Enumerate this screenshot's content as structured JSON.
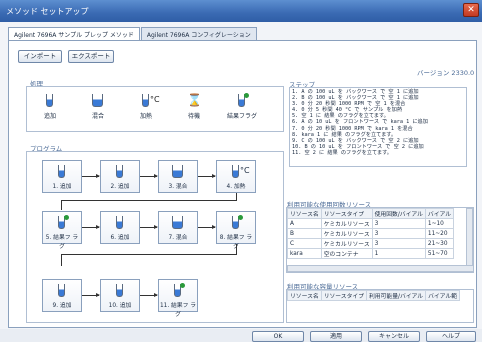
{
  "window": {
    "title": "メソッド セットアップ"
  },
  "tabs": [
    "Agilent 7696A サンプル プレップ メソッド",
    "Agilent 7696A コンフィグレーション"
  ],
  "toolbar": {
    "import_label": "インポート",
    "export_label": "エクスポート"
  },
  "version": "バージョン 2330.0",
  "process": {
    "label": "処理",
    "items": [
      {
        "label": "追加",
        "icon": "add-tube-icon"
      },
      {
        "label": "混合",
        "icon": "mix-tube-icon"
      },
      {
        "label": "加熱",
        "icon": "heat-tube-icon",
        "unit": "°C"
      },
      {
        "label": "待機",
        "icon": "hourglass-icon"
      },
      {
        "label": "結果フラグ",
        "icon": "result-flag-icon"
      }
    ]
  },
  "steps": {
    "label": "ステップ",
    "lines": [
      "1. A の 100 uL を バックワース で 空 1 に追加",
      "2. B の 100 uL を バックワース で 空 1 に追加",
      "3. 0 分 20 秒間 1000 RPM で 空 1 を混合",
      "4. 0 分 5 秒間 40 °C で サンプル を加熱",
      "5. 空 1 に 結果 のフラグを立てます。",
      "6. A の 10 uL を フロントワース で kara 1 に追加",
      "7. 0 分 20 秒間 1000 RPM で kara 1 を混合",
      "8. kara 1 に 結果 のフラグを立てます。",
      "9. C の 100 uL を バックワース で 空 2 に追加",
      "10. B の 10 uL を フロントワース で 空 2 に追加",
      "11. 空 2 に 結果 のフラグを立てます。"
    ]
  },
  "program": {
    "label": "プログラム",
    "cards": [
      {
        "label": "1. 追加",
        "icon": "add-tube-icon"
      },
      {
        "label": "2. 追加",
        "icon": "add-tube-icon"
      },
      {
        "label": "3. 混合",
        "icon": "mix-tube-icon"
      },
      {
        "label": "4. 加熱",
        "icon": "heat-tube-icon",
        "unit": "°C"
      },
      {
        "label": "5. 結果フ ラグ",
        "icon": "result-flag-icon"
      },
      {
        "label": "6. 追加",
        "icon": "add-tube-icon"
      },
      {
        "label": "7. 混合",
        "icon": "mix-tube-icon"
      },
      {
        "label": "8. 結果フ ラグ",
        "icon": "result-flag-icon"
      },
      {
        "label": "9. 追加",
        "icon": "add-tube-icon"
      },
      {
        "label": "10. 追加",
        "icon": "add-tube-icon"
      },
      {
        "label": "11. 結果フ ラグ",
        "icon": "result-flag-icon"
      }
    ]
  },
  "resources": {
    "label": "利用可能な使用回数リソース",
    "headers": [
      "リソース名",
      "リソースタイプ",
      "使用回数/バイアル",
      "バイアル"
    ],
    "rows": [
      [
        "A",
        "ケミカルリソース",
        "3",
        "1~10"
      ],
      [
        "B",
        "ケミカルリソース",
        "3",
        "11~20"
      ],
      [
        "C",
        "ケミカルリソース",
        "3",
        "21~30"
      ],
      [
        "kara",
        "空のコンテナ",
        "1",
        "51~70"
      ]
    ]
  },
  "capacity": {
    "label": "利用可能な容量リソース",
    "headers": [
      "リソース名",
      "リソースタイプ",
      "利用可能量/バイアル",
      "バイアル範"
    ]
  },
  "footer": {
    "ok": "OK",
    "apply": "適用",
    "cancel": "キャンセル",
    "help": "ヘルプ"
  }
}
